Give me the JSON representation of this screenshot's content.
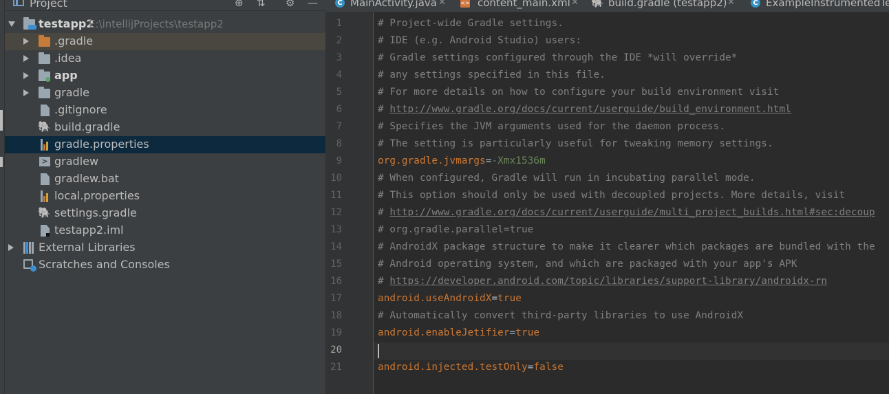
{
  "project_panel": {
    "title": "Project",
    "header_icons": [
      "target-icon",
      "collapse-icon",
      "gear-icon",
      "minimize-icon"
    ],
    "root": {
      "name": "testapp2",
      "path": "E:\\intellijProjects\\testapp2"
    },
    "items": [
      {
        "label": ".gradle",
        "type": "folder",
        "color": "#c57b3a"
      },
      {
        "label": ".idea",
        "type": "folder",
        "color": "#9aa7b0"
      },
      {
        "label": "app",
        "type": "module",
        "color": "#9aa7b0"
      },
      {
        "label": "gradle",
        "type": "folder",
        "color": "#9aa7b0"
      },
      {
        "label": ".gitignore",
        "type": "file"
      },
      {
        "label": "build.gradle",
        "type": "gradle"
      },
      {
        "label": "gradle.properties",
        "type": "properties"
      },
      {
        "label": "gradlew",
        "type": "script"
      },
      {
        "label": "gradlew.bat",
        "type": "file"
      },
      {
        "label": "local.properties",
        "type": "properties"
      },
      {
        "label": "settings.gradle",
        "type": "gradle"
      },
      {
        "label": "testapp2.iml",
        "type": "file"
      }
    ],
    "external_libraries": "External Libraries",
    "scratches": "Scratches and Consoles"
  },
  "tabs": [
    {
      "label": "MainActivity.java",
      "icon": "java-class-icon"
    },
    {
      "label": "content_main.xml",
      "icon": "xml-icon"
    },
    {
      "label": "build.gradle (testapp2)",
      "icon": "gradle-icon"
    },
    {
      "label": "ExampleInstrumentedTe",
      "icon": "java-class-icon"
    }
  ],
  "editor": {
    "line_numbers": [
      "1",
      "2",
      "3",
      "4",
      "5",
      "6",
      "7",
      "8",
      "9",
      "10",
      "11",
      "12",
      "13",
      "14",
      "15",
      "16",
      "17",
      "18",
      "19",
      "20",
      "21"
    ],
    "lines": {
      "l1": "# Project-wide Gradle settings.",
      "l2": "# IDE (e.g. Android Studio) users:",
      "l3": "# Gradle settings configured through the IDE *will override*",
      "l4": "# any settings specified in this file.",
      "l5": "# For more details on how to configure your build environment visit",
      "l6_hash": "# ",
      "l6_link": "http://www.gradle.org/docs/current/userguide/build_environment.html",
      "l7": "# Specifies the JVM arguments used for the daemon process.",
      "l8": "# The setting is particularly useful for tweaking memory settings.",
      "l9_key": "org.gradle.jvmargs",
      "l9_val": "-Xmx1536m",
      "l10": "# When configured, Gradle will run in incubating parallel mode.",
      "l11": "# This option should only be used with decoupled projects. More details, visit",
      "l12_hash": "# ",
      "l12_link": "http://www.gradle.org/docs/current/userguide/multi_project_builds.html#sec:decoup",
      "l13": "# org.gradle.parallel=true",
      "l14": "# AndroidX package structure to make it clearer which packages are bundled with the",
      "l15": "# Android operating system, and which are packaged with your app's APK",
      "l16_hash": "# ",
      "l16_link": "https://developer.android.com/topic/libraries/support-library/androidx-rn",
      "l17_key": "android.useAndroidX",
      "l17_val": "true",
      "l18": "# Automatically convert third-party libraries to use AndroidX",
      "l19_key": "android.enableJetifier",
      "l19_val": "true",
      "l21_key": "android.injected.testOnly",
      "l21_val": "false",
      "eq": "="
    },
    "current_line": "20"
  },
  "colors": {
    "comment": "#808080",
    "key": "#cc7832",
    "value": "#6a8759",
    "selection": "#0d293e"
  }
}
